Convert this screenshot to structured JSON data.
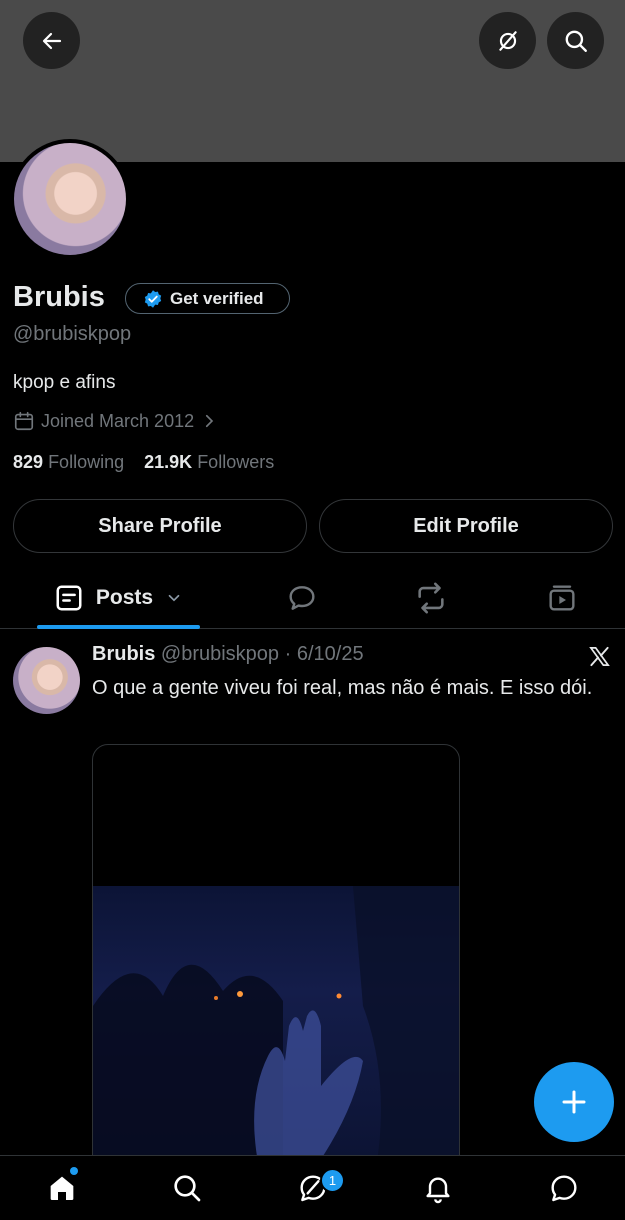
{
  "profile": {
    "name": "Brubis",
    "handle": "@brubiskpop",
    "verify_label": "Get verified",
    "bio": "kpop e afins",
    "joined": "Joined March 2012",
    "following_count": "829",
    "following_label": "Following",
    "followers_count": "21.9K",
    "followers_label": "Followers"
  },
  "buttons": {
    "share": "Share Profile",
    "edit": "Edit Profile"
  },
  "tabs": {
    "posts_label": "Posts"
  },
  "post": {
    "name": "Brubis",
    "handle": "@brubiskpop",
    "separator": " · ",
    "date": "6/10/25",
    "text": "O que a gente viveu foi real, mas não é mais. E isso dói."
  },
  "nav": {
    "messages_badge": "1"
  },
  "colors": {
    "accent": "#1d9bf0",
    "background": "#000000",
    "banner": "#4a4a4a"
  }
}
